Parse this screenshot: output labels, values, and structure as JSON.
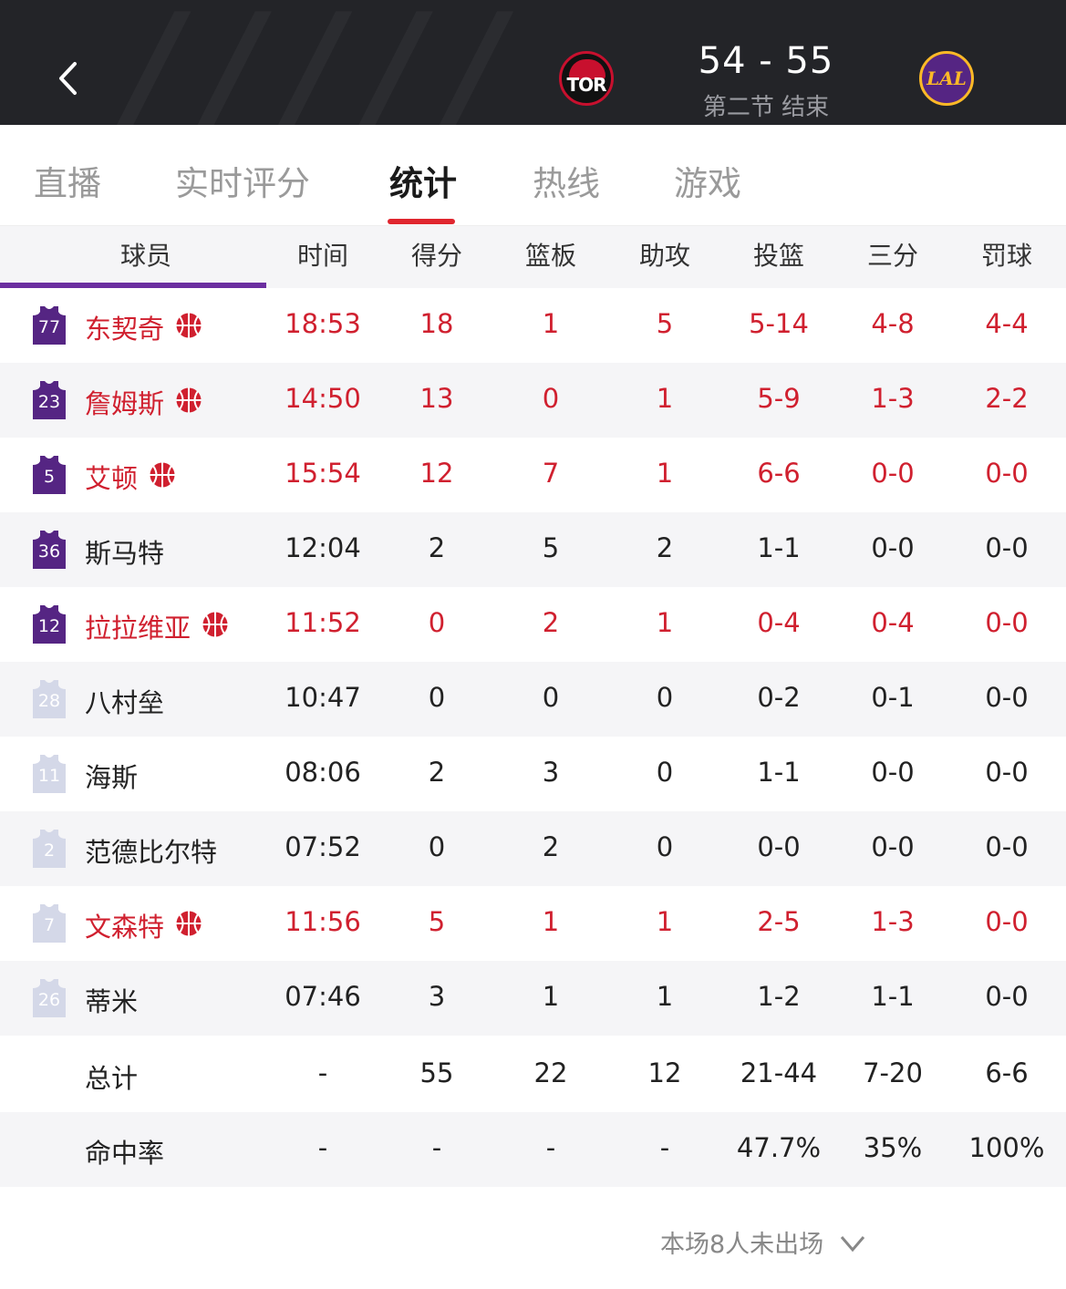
{
  "header": {
    "score": "54 - 55",
    "period": "第二节 结束",
    "home_logo": "TOR",
    "away_logo": "LAL"
  },
  "tabs": [
    {
      "label": "直播",
      "active": false
    },
    {
      "label": "实时评分",
      "active": false
    },
    {
      "label": "统计",
      "active": true
    },
    {
      "label": "热线",
      "active": false
    },
    {
      "label": "游戏",
      "active": false
    }
  ],
  "columns": [
    "球员",
    "时间",
    "得分",
    "篮板",
    "助攻",
    "投篮",
    "三分",
    "罚球"
  ],
  "colors": {
    "team_purple": "#552583",
    "accent_red": "#d0202f",
    "bench_jersey": "#d4d8e8"
  },
  "players": [
    {
      "number": "77",
      "name": "东契奇",
      "starter": true,
      "stats": [
        "18:53",
        "18",
        "1",
        "5",
        "5-14",
        "4-8",
        "4-4"
      ]
    },
    {
      "number": "23",
      "name": "詹姆斯",
      "starter": true,
      "stats": [
        "14:50",
        "13",
        "0",
        "1",
        "5-9",
        "1-3",
        "2-2"
      ]
    },
    {
      "number": "5",
      "name": "艾顿",
      "starter": true,
      "stats": [
        "15:54",
        "12",
        "7",
        "1",
        "6-6",
        "0-0",
        "0-0"
      ]
    },
    {
      "number": "36",
      "name": "斯马特",
      "starter": false,
      "stats": [
        "12:04",
        "2",
        "5",
        "2",
        "1-1",
        "0-0",
        "0-0"
      ]
    },
    {
      "number": "12",
      "name": "拉拉维亚",
      "starter": true,
      "stats": [
        "11:52",
        "0",
        "2",
        "1",
        "0-4",
        "0-4",
        "0-0"
      ]
    },
    {
      "number": "28",
      "name": "八村垒",
      "starter": false,
      "stats": [
        "10:47",
        "0",
        "0",
        "0",
        "0-2",
        "0-1",
        "0-0"
      ]
    },
    {
      "number": "11",
      "name": "海斯",
      "starter": false,
      "stats": [
        "08:06",
        "2",
        "3",
        "0",
        "1-1",
        "0-0",
        "0-0"
      ]
    },
    {
      "number": "2",
      "name": "范德比尔特",
      "starter": false,
      "stats": [
        "07:52",
        "0",
        "2",
        "0",
        "0-0",
        "0-0",
        "0-0"
      ]
    },
    {
      "number": "7",
      "name": "文森特",
      "starter": true,
      "stats": [
        "11:56",
        "5",
        "1",
        "1",
        "2-5",
        "1-3",
        "0-0"
      ]
    },
    {
      "number": "26",
      "name": "蒂米",
      "starter": false,
      "stats": [
        "07:46",
        "3",
        "1",
        "1",
        "1-2",
        "1-1",
        "0-0"
      ]
    }
  ],
  "totals": {
    "label": "总计",
    "stats": [
      "-",
      "55",
      "22",
      "12",
      "21-44",
      "7-20",
      "6-6"
    ]
  },
  "percent": {
    "label": "命中率",
    "stats": [
      "-",
      "-",
      "-",
      "-",
      "47.7%",
      "35%",
      "100%"
    ]
  },
  "footer": {
    "dnp_text": "本场8人未出场"
  }
}
